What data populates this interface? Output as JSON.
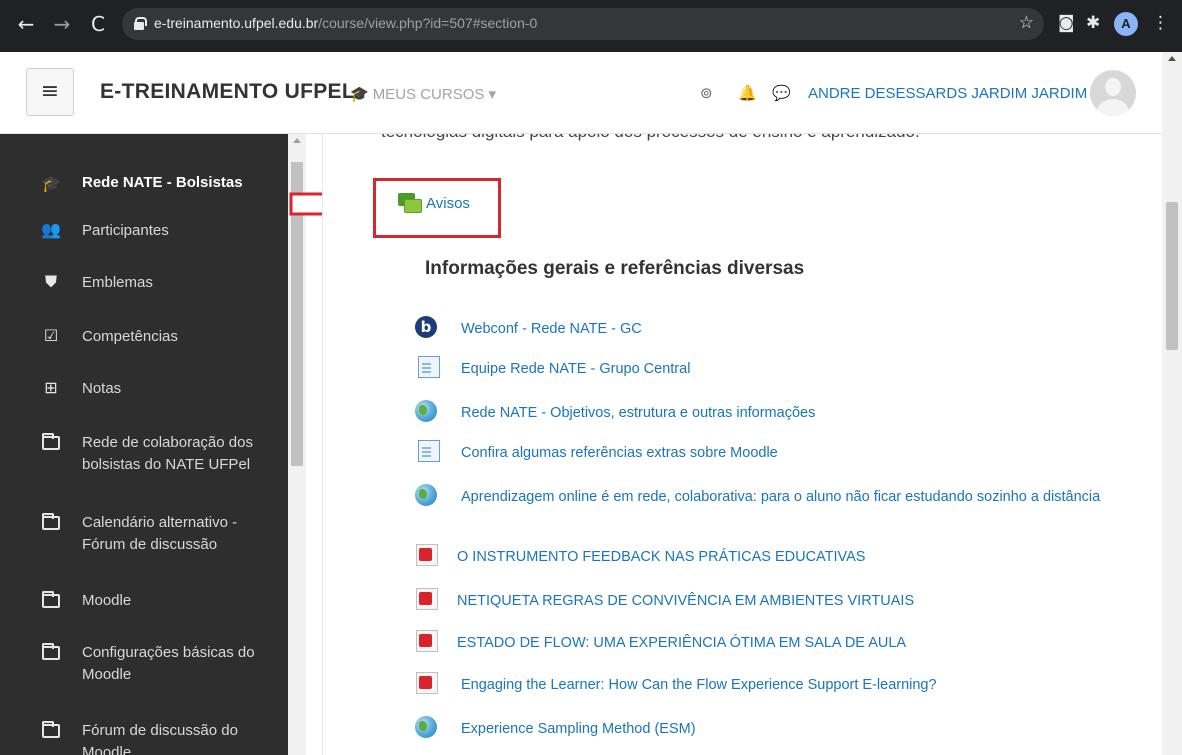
{
  "browser": {
    "url_host": "e-treinamento.ufpel.edu.br",
    "url_path": "/course/view.php?id=507#section-0",
    "profile_initial": "A"
  },
  "navbar": {
    "menu_toggle": "≡",
    "brand": "E-TREINAMENTO UFPEL",
    "my_courses": "MEUS CURSOS ▾",
    "username": "ANDRE DESESSARDS JARDIM JARDIM"
  },
  "sidebar": {
    "items": [
      {
        "label": "Rede NATE - Bolsistas",
        "icon": "graduation-cap-icon"
      },
      {
        "label": "Participantes",
        "icon": "users-icon"
      },
      {
        "label": "Emblemas",
        "icon": "shield-icon"
      },
      {
        "label": "Competências",
        "icon": "checkbox-icon"
      },
      {
        "label": "Notas",
        "icon": "table-icon"
      },
      {
        "label": "Rede de colaboração dos bolsistas do NATE UFPel",
        "icon": "folder-icon"
      },
      {
        "label": "Calendário alternativo - Fórum de discussão",
        "icon": "folder-icon"
      },
      {
        "label": "Moodle",
        "icon": "folder-icon"
      },
      {
        "label": "Configurações básicas do Moodle",
        "icon": "folder-icon"
      },
      {
        "label": "Fórum de discussão do Moodle",
        "icon": "folder-icon"
      }
    ]
  },
  "main": {
    "cut_text": "tecnologias digitais para apoio dos processos de ensino e aprendizado.",
    "avisos": "Avisos",
    "section_title": "Informações gerais e referências diversas",
    "activities": [
      {
        "label": "Webconf - Rede NATE - GC",
        "icon": "bigbluebutton-icon"
      },
      {
        "label": "Equipe Rede NATE - Grupo Central",
        "icon": "page-icon"
      },
      {
        "label": "Rede NATE - Objetivos, estrutura e outras informações",
        "icon": "url-globe-icon"
      },
      {
        "label": "Confira algumas referências extras sobre Moodle",
        "icon": "page-icon"
      },
      {
        "label": "Aprendizagem online é em rede, colaborativa: para o aluno não ficar estudando sozinho a distância",
        "icon": "url-globe-icon"
      },
      {
        "label": "O INSTRUMENTO FEEDBACK NAS PRÁTICAS EDUCATIVAS",
        "icon": "pdf-icon"
      },
      {
        "label": "NETIQUETA REGRAS DE CONVIVÊNCIA EM AMBIENTES VIRTUAIS",
        "icon": "pdf-icon"
      },
      {
        "label": "ESTADO DE FLOW: UMA EXPERIÊNCIA ÓTIMA EM SALA DE AULA",
        "icon": "pdf-icon"
      },
      {
        "label": "Engaging the Learner: How Can the Flow Experience Support E-learning?",
        "icon": "pdf-icon"
      },
      {
        "label": "Experience Sampling Method (ESM)",
        "icon": "url-globe-icon"
      }
    ]
  },
  "colors": {
    "link": "#1a75bb",
    "sidebar_bg": "#2e2e2e",
    "highlight": "#d6262e"
  }
}
